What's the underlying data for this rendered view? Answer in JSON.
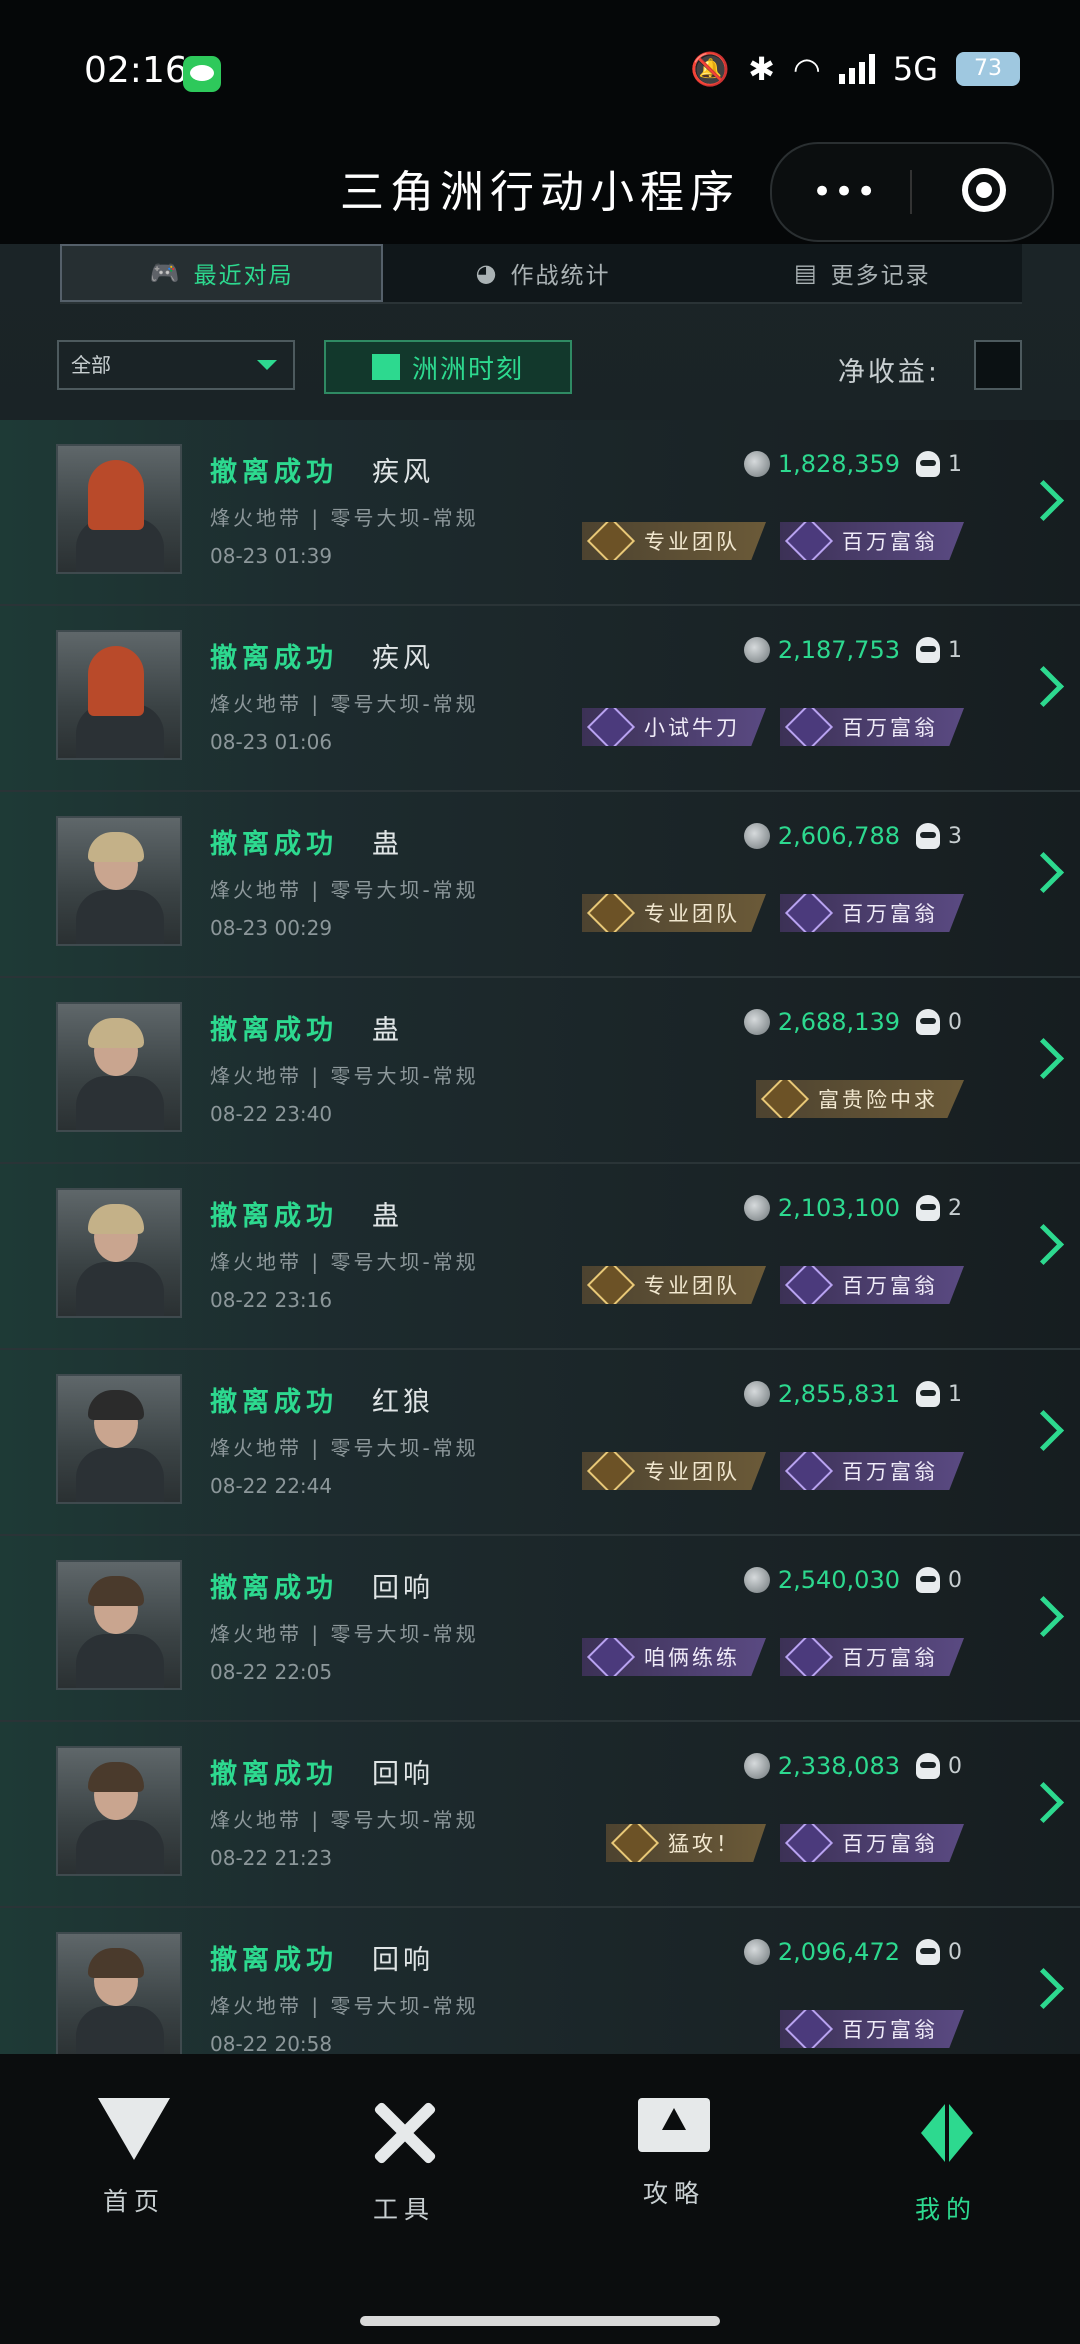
{
  "status": {
    "time": "02:16",
    "network": "5G",
    "battery": "73"
  },
  "titlebar": {
    "title": "三角洲行动小程序",
    "more": "•••"
  },
  "tabs": [
    {
      "label": "最近对局",
      "icon": "gamepad-icon",
      "active": true
    },
    {
      "label": "作战统计",
      "icon": "pie-icon",
      "active": false
    },
    {
      "label": "更多记录",
      "icon": "document-icon",
      "active": false
    }
  ],
  "filters": {
    "select_value": "全部",
    "moment_label": "洲洲时刻",
    "net_label": "净收益:"
  },
  "matches": [
    {
      "result": "撤离成功",
      "operator": "疾风",
      "map": "烽火地带 | 零号大坝-常规",
      "time": "08-23 01:39",
      "value": "1,828,359",
      "kills": "1",
      "badges": [
        {
          "label": "专业团队",
          "tone": "gold"
        },
        {
          "label": "百万富翁",
          "tone": "purple"
        }
      ]
    },
    {
      "result": "撤离成功",
      "operator": "疾风",
      "map": "烽火地带 | 零号大坝-常规",
      "time": "08-23 01:06",
      "value": "2,187,753",
      "kills": "1",
      "badges": [
        {
          "label": "小试牛刀",
          "tone": "purple"
        },
        {
          "label": "百万富翁",
          "tone": "purple"
        }
      ]
    },
    {
      "result": "撤离成功",
      "operator": "蛊",
      "map": "烽火地带 | 零号大坝-常规",
      "time": "08-23 00:29",
      "value": "2,606,788",
      "kills": "3",
      "badges": [
        {
          "label": "专业团队",
          "tone": "gold"
        },
        {
          "label": "百万富翁",
          "tone": "purple"
        }
      ]
    },
    {
      "result": "撤离成功",
      "operator": "蛊",
      "map": "烽火地带 | 零号大坝-常规",
      "time": "08-22 23:40",
      "value": "2,688,139",
      "kills": "0",
      "badges": [
        {
          "label": "富贵险中求",
          "tone": "gold"
        }
      ]
    },
    {
      "result": "撤离成功",
      "operator": "蛊",
      "map": "烽火地带 | 零号大坝-常规",
      "time": "08-22 23:16",
      "value": "2,103,100",
      "kills": "2",
      "badges": [
        {
          "label": "专业团队",
          "tone": "gold"
        },
        {
          "label": "百万富翁",
          "tone": "purple"
        }
      ]
    },
    {
      "result": "撤离成功",
      "operator": "红狼",
      "map": "烽火地带 | 零号大坝-常规",
      "time": "08-22 22:44",
      "value": "2,855,831",
      "kills": "1",
      "badges": [
        {
          "label": "专业团队",
          "tone": "gold"
        },
        {
          "label": "百万富翁",
          "tone": "purple"
        }
      ]
    },
    {
      "result": "撤离成功",
      "operator": "回响",
      "map": "烽火地带 | 零号大坝-常规",
      "time": "08-22 22:05",
      "value": "2,540,030",
      "kills": "0",
      "badges": [
        {
          "label": "咱俩练练",
          "tone": "purple"
        },
        {
          "label": "百万富翁",
          "tone": "purple"
        }
      ]
    },
    {
      "result": "撤离成功",
      "operator": "回响",
      "map": "烽火地带 | 零号大坝-常规",
      "time": "08-22 21:23",
      "value": "2,338,083",
      "kills": "0",
      "badges": [
        {
          "label": "猛攻！",
          "tone": "gold"
        },
        {
          "label": "百万富翁",
          "tone": "purple"
        }
      ]
    },
    {
      "result": "撤离成功",
      "operator": "回响",
      "map": "烽火地带 | 零号大坝-常规",
      "time": "08-22 20:58",
      "value": "2,096,472",
      "kills": "0",
      "badges": [
        {
          "label": "百万富翁",
          "tone": "purple"
        }
      ]
    }
  ],
  "nav": [
    {
      "label": "首页",
      "icon": "home-icon",
      "active": false
    },
    {
      "label": "工具",
      "icon": "tools-icon",
      "active": false
    },
    {
      "label": "攻略",
      "icon": "guide-icon",
      "active": false
    },
    {
      "label": "我的",
      "icon": "profile-icon",
      "active": true
    }
  ],
  "colors": {
    "accent": "#2dd98f",
    "gold": "#6b5a38",
    "purple": "#5a4a82"
  }
}
